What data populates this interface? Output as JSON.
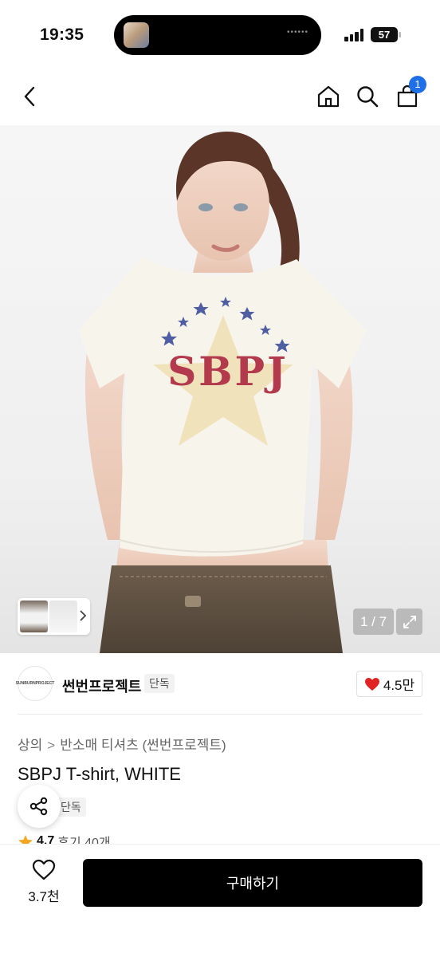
{
  "status_bar": {
    "time": "19:35",
    "battery": "57"
  },
  "nav": {
    "back_icon": "chevron-left-icon",
    "home_icon": "home-icon",
    "search_icon": "search-icon",
    "cart_icon": "shopping-bag-icon",
    "cart_count": "1"
  },
  "hero": {
    "graphic_text": "SBPJ",
    "page_counter": "1 / 7",
    "expand_icon": "expand-icon"
  },
  "brand": {
    "logo_text": "SUNBURNPROJECT",
    "name": "썬번프로젝트",
    "tag": "단독",
    "likes": "4.5만"
  },
  "breadcrumb": {
    "category": "상의",
    "subcategory": "반소매 티셔츠 (썬번프로젝트)"
  },
  "product": {
    "title": "SBPJ T-shirt, WHITE",
    "exclusive_tag": "단독"
  },
  "rating": {
    "score": "4.7",
    "reviews": "후기 40개"
  },
  "bottom_bar": {
    "wish_count": "3.7천",
    "buy_label": "구매하기"
  },
  "colors": {
    "accent_badge": "#1f6fe8",
    "heart": "#e02424",
    "star": "#f5a623",
    "buy_button": "#000000"
  }
}
